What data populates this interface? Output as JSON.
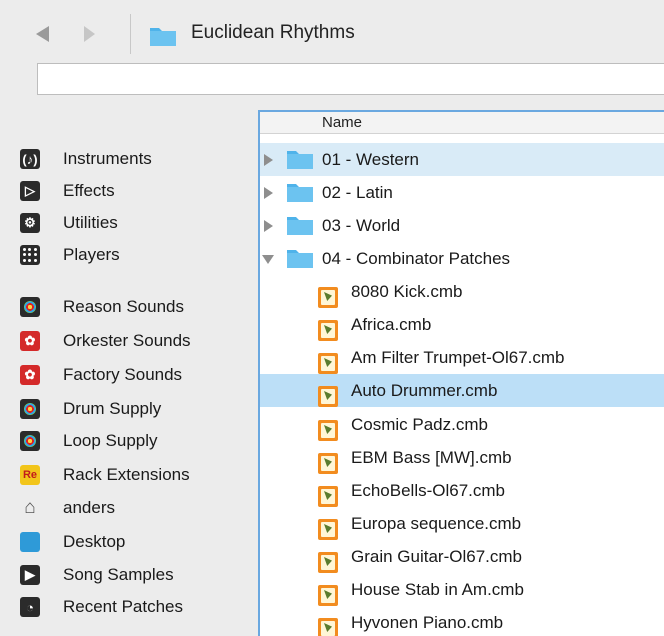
{
  "toolbar": {
    "path_title": "Euclidean Rhythms"
  },
  "sidebar": {
    "items": [
      {
        "label": "Instruments",
        "icon": "instruments-icon"
      },
      {
        "label": "Effects",
        "icon": "effects-icon"
      },
      {
        "label": "Utilities",
        "icon": "utilities-icon"
      },
      {
        "label": "Players",
        "icon": "players-icon"
      },
      {
        "label": "Reason Sounds",
        "icon": "reason-sounds-icon"
      },
      {
        "label": "Orkester Sounds",
        "icon": "orkester-sounds-icon"
      },
      {
        "label": "Factory Sounds",
        "icon": "factory-sounds-icon"
      },
      {
        "label": "Drum Supply",
        "icon": "drum-supply-icon"
      },
      {
        "label": "Loop Supply",
        "icon": "loop-supply-icon"
      },
      {
        "label": "Rack Extensions",
        "icon": "rack-extensions-icon",
        "badge": "Re"
      },
      {
        "label": "anders",
        "icon": "home-icon"
      },
      {
        "label": "Desktop",
        "icon": "desktop-folder-icon"
      },
      {
        "label": "Song Samples",
        "icon": "song-samples-icon"
      },
      {
        "label": "Recent Patches",
        "icon": "recent-patches-icon"
      }
    ]
  },
  "list": {
    "column_name": "Name",
    "folders": [
      {
        "label": "01 - Western",
        "expanded": false
      },
      {
        "label": "02 - Latin",
        "expanded": false
      },
      {
        "label": "03 - World",
        "expanded": false
      },
      {
        "label": "04 - Combinator Patches",
        "expanded": true
      }
    ],
    "files": [
      "8080 Kick.cmb",
      "Africa.cmb",
      "Am Filter Trumpet-Ol67.cmb",
      "Auto Drummer.cmb",
      "Cosmic Padz.cmb",
      "EBM Bass [MW].cmb",
      "EchoBells-Ol67.cmb",
      "Europa sequence.cmb",
      "Grain Guitar-Ol67.cmb",
      "House Stab in Am.cmb",
      "Hyvonen Piano.cmb"
    ],
    "selected_file": "Auto Drummer.cmb"
  },
  "colors": {
    "folder_blue": "#4fb3ea",
    "selection": "#bcdff7",
    "focus_border": "#6aa8e0"
  }
}
